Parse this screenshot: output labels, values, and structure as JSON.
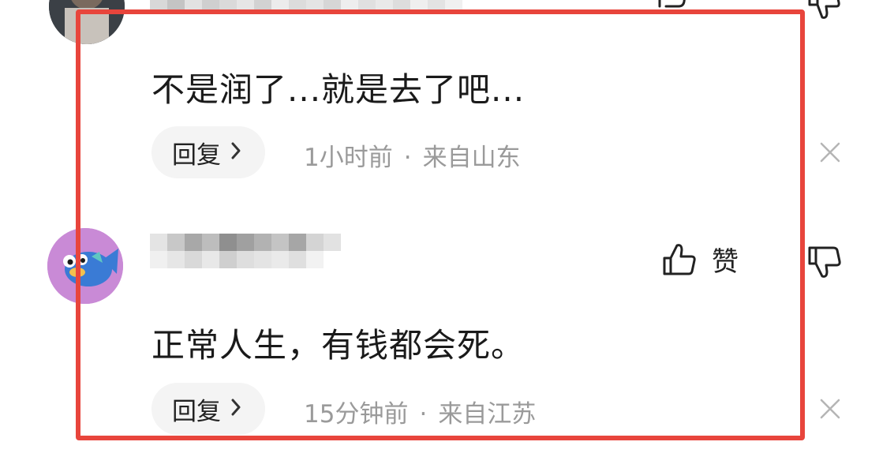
{
  "comments": [
    {
      "text": "不是润了...就是去了吧...",
      "reply_label": "回复",
      "time": "1小时前",
      "separator": "·",
      "location": "来自山东"
    },
    {
      "text": "正常人生，有钱都会死。",
      "reply_label": "回复",
      "time": "15分钟前",
      "separator": "·",
      "location": "来自江苏",
      "like_label": "赞"
    }
  ],
  "colors": {
    "highlight": "#e8453c",
    "meta_text": "#9a9a9a",
    "reply_bg": "#f4f4f4"
  },
  "icons": {
    "like": "thumbs-up-icon",
    "dislike": "thumbs-down-icon",
    "close": "close-icon",
    "reply_chevron": "chevron-right-icon"
  }
}
